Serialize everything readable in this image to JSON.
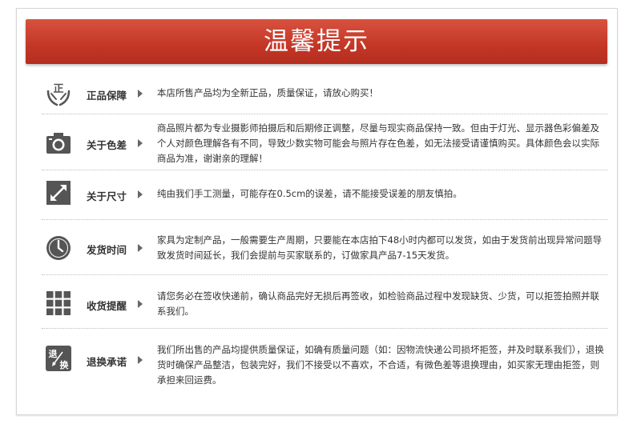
{
  "banner": {
    "title": "温馨提示"
  },
  "rows": [
    {
      "label": "正品保障",
      "icon": "genuine-hands-icon",
      "icon_text": "正",
      "text": "本店所售产品均为全新正品，质量保证，请放心购买！"
    },
    {
      "label": "关于色差",
      "icon": "camera-icon",
      "text": "商品照片都为专业摄影师拍摄后和后期修正调整，尽量与现实商品保持一致。但由于灯光、显示器色彩偏差及个人对颜色理解各有不同，导致少数实物可能会与照片存在色差，如无法接受请谨慎购买。具体颜色会以实际商品为准，谢谢亲的理解！"
    },
    {
      "label": "关于尺寸",
      "icon": "resize-arrow-icon",
      "text": "纯由我们手工测量，可能存在0.5cm的误差，请不能接受误差的朋友慎拍。"
    },
    {
      "label": "发货时间",
      "icon": "clock-icon",
      "text": "家具为定制产品，一般需要生产周期，只要能在本店拍下48小时内都可以发货，如由于发货前出现异常问题导致发货时间延长，我们会提前与买家联系的，订做家具产品7-15天发货。"
    },
    {
      "label": "收货提醒",
      "icon": "grid-icon",
      "text": "请您务必在签收快递前，确认商品完好无损后再签收，如检验商品过程中发现缺货、少货，可以拒签拍照并联系我们。"
    },
    {
      "label": "退换承诺",
      "icon": "return-exchange-icon",
      "icon_text_top": "退",
      "icon_text_bottom": "换",
      "text": "我们所出售的产品均提供质量保证，如确有质量问题（如：因物流快递公司损坏拒签，并及时联系我们），退换货时确保产品整洁，包装完好，我们不接受以不喜欢，不合适，有微色差等退换理由，如买家无理由拒签，则承担来回运费。"
    }
  ],
  "colors": {
    "banner": "#c33626",
    "icon": "#555555",
    "text": "#333333"
  }
}
